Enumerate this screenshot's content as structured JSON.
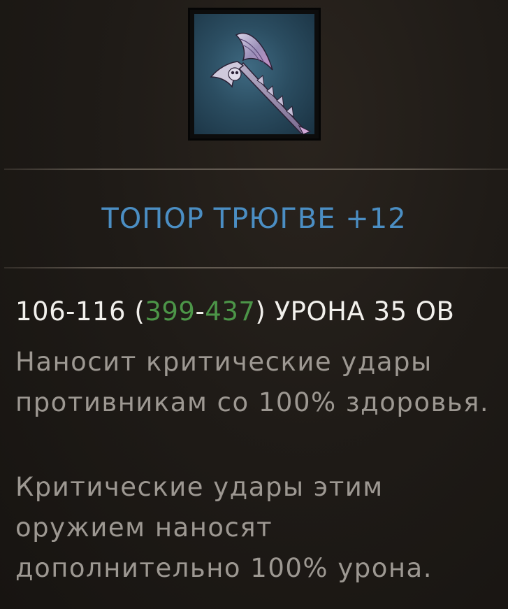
{
  "item": {
    "name": "ТОПОР ТРЮГВЕ +12",
    "icon": "battle-axe-icon"
  },
  "damage": {
    "base": "106-116",
    "open_paren": "(",
    "upgraded_min": "399",
    "dash": "-",
    "upgraded_max": "437",
    "close_paren": ")",
    "suffix": " УРОНА 35 ОВ"
  },
  "affixes": [
    {
      "text": "Наносит критические удары противникам со 100% здоровья."
    },
    {
      "text": "Критические удары этим оружием наносят дополнительно 100% урона."
    }
  ],
  "colors": {
    "name": "#4b8ec3",
    "upgraded_value": "#4c9548",
    "description": "#9d9892",
    "primary_stat": "#f2f0ec"
  }
}
